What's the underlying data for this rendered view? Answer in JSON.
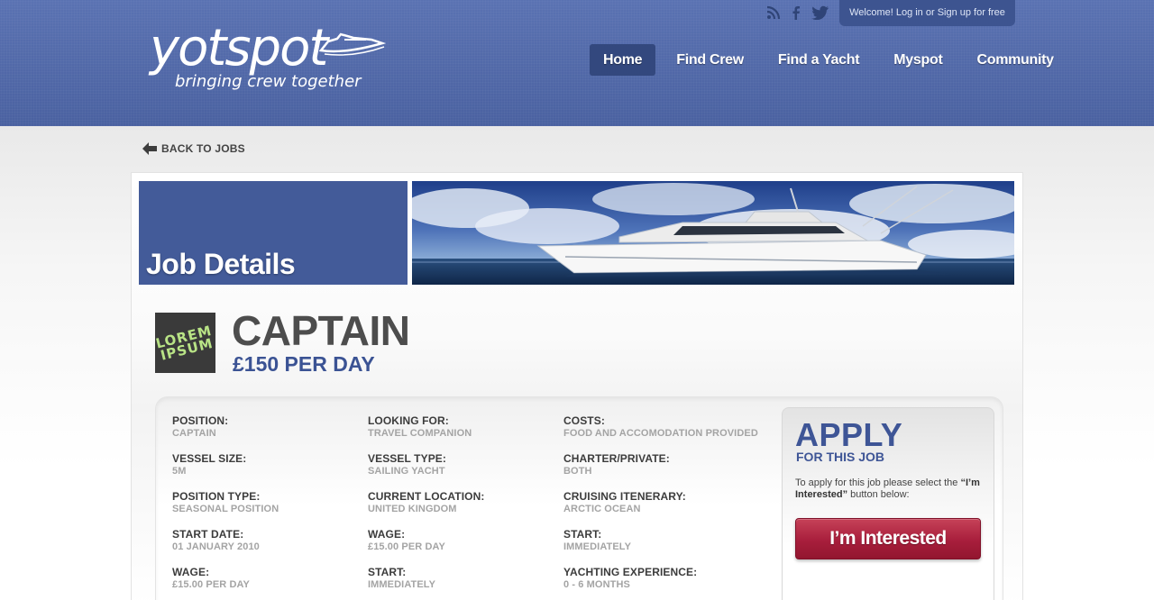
{
  "header": {
    "logo_word": "yotspot",
    "logo_tagline": "bringing crew together",
    "welcome_text": "Welcome! Log in or Sign up for free",
    "social_icons": [
      "rss-icon",
      "facebook-icon",
      "twitter-icon"
    ],
    "nav": [
      {
        "label": "Home",
        "active": true
      },
      {
        "label": "Find Crew",
        "active": false
      },
      {
        "label": "Find a Yacht",
        "active": false
      },
      {
        "label": "Myspot",
        "active": false
      },
      {
        "label": "Community",
        "active": false
      }
    ]
  },
  "back_link": {
    "label": "BACK TO JOBS",
    "icon": "arrow-left-icon"
  },
  "job": {
    "section_title": "Job Details",
    "company_logo_text": "LOREM\nIPSUM",
    "title": "CAPTAIN",
    "rate": "£150 PER DAY"
  },
  "details": {
    "columns": [
      [
        {
          "label": "POSITION:",
          "value": "CAPTAIN"
        },
        {
          "label": "VESSEL SIZE:",
          "value": "5M"
        },
        {
          "label": "POSITION TYPE:",
          "value": "SEASONAL POSITION"
        },
        {
          "label": "START DATE:",
          "value": "01 JANUARY 2010"
        },
        {
          "label": "WAGE:",
          "value": "£15.00 PER DAY"
        }
      ],
      [
        {
          "label": "LOOKING FOR:",
          "value": "TRAVEL COMPANION"
        },
        {
          "label": "VESSEL TYPE:",
          "value": "SAILING YACHT"
        },
        {
          "label": "CURRENT LOCATION:",
          "value": "UNITED KINGDOM"
        },
        {
          "label": "WAGE:",
          "value": "£15.00 PER DAY"
        },
        {
          "label": "START:",
          "value": "IMMEDIATELY"
        }
      ],
      [
        {
          "label": "COSTS:",
          "value": "FOOD AND ACCOMODATION PROVIDED"
        },
        {
          "label": "CHARTER/PRIVATE:",
          "value": "BOTH"
        },
        {
          "label": "CRUISING ITENERARY:",
          "value": "ARCTIC OCEAN"
        },
        {
          "label": "START:",
          "value": "IMMEDIATELY"
        },
        {
          "label": "YACHTING EXPERIENCE:",
          "value": "0 - 6 MONTHS"
        }
      ]
    ]
  },
  "apply": {
    "title": "APPLY",
    "subtitle": "FOR THIS JOB",
    "instructions_prefix": "To apply for this job please select the ",
    "instructions_emphasis": "“I’m Interested”",
    "instructions_suffix": " button below:",
    "button_label": "I’m Interested"
  },
  "colors": {
    "header_blue": "#4e66a6",
    "nav_active": "#33487e",
    "title_blue": "#3b5394",
    "button_red": "#a81e3c"
  }
}
